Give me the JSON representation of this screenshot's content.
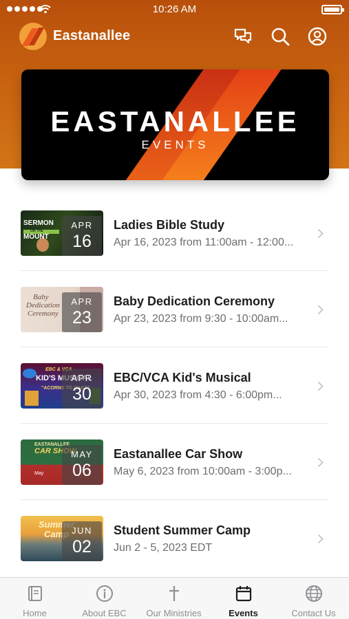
{
  "status_bar": {
    "time": "10:26 AM"
  },
  "header": {
    "app_name": "Eastanallee"
  },
  "banner": {
    "title": "EASTANALLEE",
    "subtitle": "EVENTS"
  },
  "events": [
    {
      "title": "Ladies Bible Study",
      "subtitle": "Apr 16, 2023 from 11:00am - 12:00...",
      "month": "APR",
      "day": "16",
      "thumb": {
        "line1": "SERMON",
        "line2": "ON THE",
        "line3": "MOUNT"
      }
    },
    {
      "title": "Baby Dedication Ceremony",
      "subtitle": "Apr 23, 2023 from 9:30 - 10:00am...",
      "month": "APR",
      "day": "23",
      "thumb": {
        "line1": "Baby",
        "line2": "Dedication",
        "line3": "Ceremony"
      }
    },
    {
      "title": "EBC/VCA Kid's Musical",
      "subtitle": "Apr 30, 2023 from 4:30 - 6:00pm...",
      "month": "APR",
      "day": "30",
      "thumb": {
        "line1": "EBC & VCA",
        "line2": "KID'S MUSICAL",
        "line3": "\"ACORNS TO OAKS\""
      }
    },
    {
      "title": "Eastanallee Car Show",
      "subtitle": "May 6, 2023 from 10:00am - 3:00p...",
      "month": "MAY",
      "day": "06",
      "thumb": {
        "line1": "EASTANALLEE",
        "line2": "CAR SHOW",
        "line3": "May"
      }
    },
    {
      "title": "Student Summer Camp",
      "subtitle": "Jun 2 - 5, 2023 EDT",
      "month": "JUN",
      "day": "02",
      "thumb": {
        "line1": "Summer",
        "line2": "Camp",
        "line3": ""
      }
    }
  ],
  "tabs": [
    {
      "label": "Home",
      "icon": "book-icon"
    },
    {
      "label": "About EBC",
      "icon": "info-icon"
    },
    {
      "label": "Our Ministries",
      "icon": "cross-icon"
    },
    {
      "label": "Events",
      "icon": "calendar-icon",
      "active": true
    },
    {
      "label": "Contact Us",
      "icon": "globe-icon"
    }
  ],
  "colors": {
    "header_top": "#b8500c",
    "header_bottom": "#d37417",
    "accent": "#f06a1a",
    "tab_active": "#1d1d1f",
    "tab_inactive": "#8e8e93"
  }
}
